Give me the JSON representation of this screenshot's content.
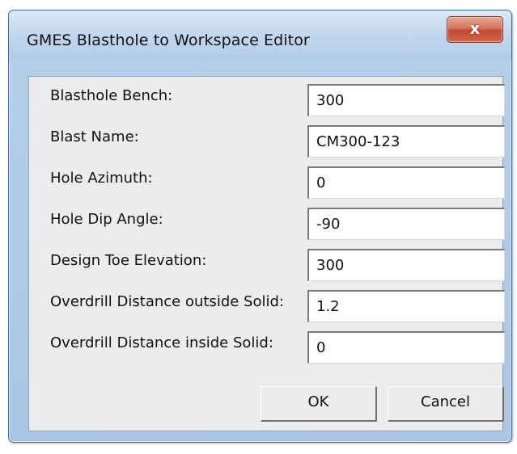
{
  "window": {
    "title": "GMES Blasthole to Workspace Editor",
    "close_label": "x"
  },
  "form": {
    "fields": [
      {
        "label": "Blasthole Bench:",
        "value": "300"
      },
      {
        "label": "Blast Name:",
        "value": "CM300-123"
      },
      {
        "label": "Hole Azimuth:",
        "value": "0"
      },
      {
        "label": "Hole Dip Angle:",
        "value": "-90"
      },
      {
        "label": "Design Toe Elevation:",
        "value": "300"
      },
      {
        "label": "Overdrill Distance outside Solid:",
        "value": "1.2"
      },
      {
        "label": "Overdrill Distance inside Solid:",
        "value": "0"
      }
    ]
  },
  "buttons": {
    "ok_label": "OK",
    "cancel_label": "Cancel"
  },
  "colors": {
    "frame": "#b5cfe9",
    "close_button": "#c24a30",
    "client_bg": "#ececec"
  }
}
